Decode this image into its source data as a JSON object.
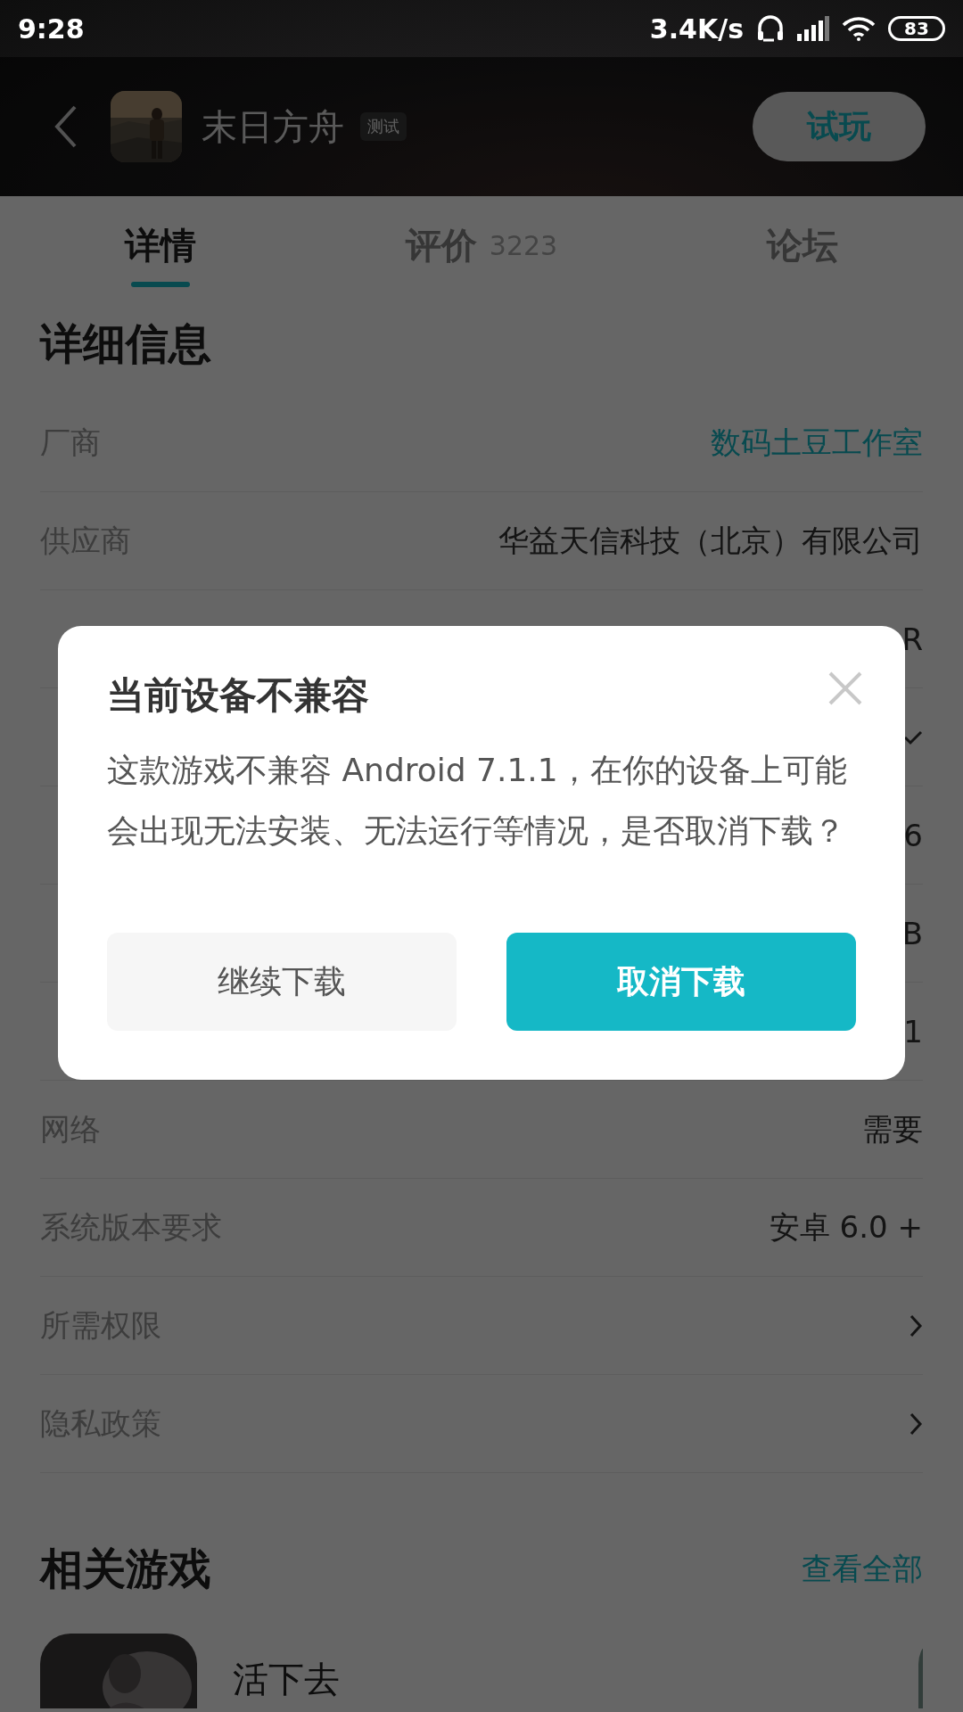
{
  "status_bar": {
    "time": "9:28",
    "speed": "3.4K/s",
    "battery": "83"
  },
  "header": {
    "title": "末日方舟",
    "tag": "测试",
    "action": "试玩"
  },
  "tabs": [
    {
      "label": "详情",
      "selected": true
    },
    {
      "label": "评价",
      "count": "3223",
      "selected": false
    },
    {
      "label": "论坛",
      "selected": false
    }
  ],
  "details": {
    "title": "详细信息",
    "rows": [
      {
        "kind": "link",
        "label": "厂商",
        "value": "数码土豆工作室"
      },
      {
        "kind": "text",
        "label": "供应商",
        "value": "华益天信科技（北京）有限公司"
      },
      {
        "kind": "text",
        "value": "R"
      },
      {
        "kind": "check"
      },
      {
        "kind": "text",
        "value": "6"
      },
      {
        "kind": "text",
        "value": "B"
      },
      {
        "kind": "text",
        "value": "1"
      },
      {
        "kind": "text",
        "label": "网络",
        "value": "需要"
      },
      {
        "kind": "text",
        "label": "系统版本要求",
        "value": "安卓 6.0 +"
      },
      {
        "kind": "arrow",
        "label": "所需权限"
      },
      {
        "kind": "arrow",
        "label": "隐私政策"
      }
    ]
  },
  "related": {
    "title": "相关游戏",
    "link": "查看全部",
    "games": [
      {
        "name": "活下去"
      }
    ]
  },
  "dialog": {
    "title": "当前设备不兼容",
    "message": "这款游戏不兼容 Android 7.1.1，在你的设备上可能会出现无法安装、无法运行等情况，是否取消下载？",
    "buttons": [
      {
        "kind": "secondary",
        "label": "继续下载"
      },
      {
        "kind": "primary",
        "label": "取消下载"
      }
    ]
  }
}
